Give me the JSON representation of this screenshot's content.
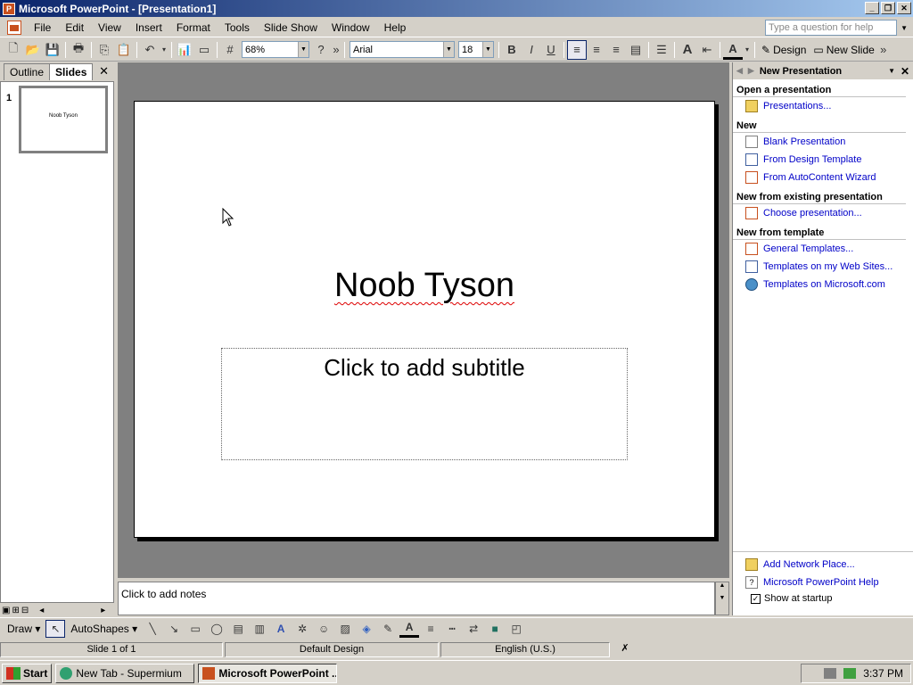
{
  "window": {
    "title": "Microsoft PowerPoint - [Presentation1]"
  },
  "menu": {
    "items": [
      "File",
      "Edit",
      "View",
      "Insert",
      "Format",
      "Tools",
      "Slide Show",
      "Window",
      "Help"
    ],
    "help_placeholder": "Type a question for help"
  },
  "toolbar": {
    "zoom": "68%",
    "font": "Arial",
    "font_size": "18",
    "design_label": "Design",
    "new_slide_label": "New Slide"
  },
  "left_pane": {
    "tabs": [
      "Outline",
      "Slides"
    ],
    "active_tab": "Slides",
    "slide_number": "1",
    "thumb_title": "Noob Tyson"
  },
  "slide": {
    "title": "Noob Tyson",
    "subtitle_placeholder": "Click to add subtitle"
  },
  "notes": {
    "placeholder": "Click to add notes"
  },
  "task_pane": {
    "title": "New Presentation",
    "sections": [
      {
        "heading": "Open a presentation",
        "links": [
          {
            "label": "Presentations...",
            "icon": "folder-icon"
          }
        ]
      },
      {
        "heading": "New",
        "links": [
          {
            "label": "Blank Presentation",
            "icon": "blank-doc-icon"
          },
          {
            "label": "From Design Template",
            "icon": "design-template-icon"
          },
          {
            "label": "From AutoContent Wizard",
            "icon": "wizard-icon"
          }
        ]
      },
      {
        "heading": "New from existing presentation",
        "links": [
          {
            "label": "Choose presentation...",
            "icon": "doc-icon"
          }
        ]
      },
      {
        "heading": "New from template",
        "links": [
          {
            "label": "General Templates...",
            "icon": "template-icon"
          },
          {
            "label": "Templates on my Web Sites...",
            "icon": "web-template-icon"
          },
          {
            "label": "Templates on Microsoft.com",
            "icon": "globe-icon"
          }
        ]
      }
    ],
    "bottom_links": [
      "Add Network Place...",
      "Microsoft PowerPoint Help"
    ],
    "show_at_startup": "Show at startup",
    "show_at_startup_checked": true
  },
  "draw_toolbar": {
    "draw_label": "Draw",
    "autoshapes_label": "AutoShapes"
  },
  "status": {
    "slide": "Slide 1 of 1",
    "design": "Default Design",
    "language": "English (U.S.)"
  },
  "taskbar": {
    "start_label": "Start",
    "tasks": [
      "New Tab - Supermium",
      "Microsoft PowerPoint ..."
    ],
    "active_task": 1,
    "clock": "3:37 PM"
  },
  "colors": {
    "title_bar": "#0a246a",
    "link": "#0000c8",
    "accent": "#c8501e",
    "workspace": "#808080"
  }
}
